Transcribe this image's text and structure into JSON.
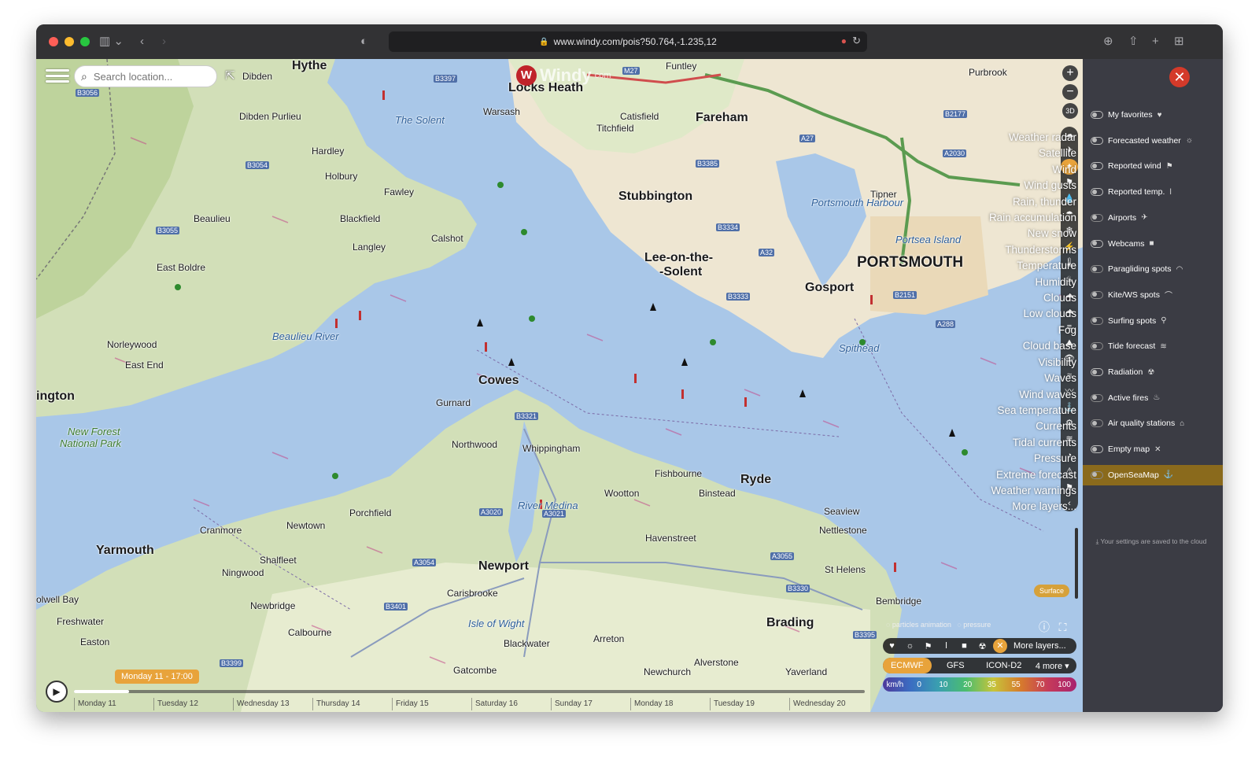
{
  "browser": {
    "url": "www.windy.com/pois?50.764,-1.235,12"
  },
  "map": {
    "search_placeholder": "Search location...",
    "logo_text": "Windy",
    "logo_suffix": "com",
    "places": [
      {
        "name": "Hythe",
        "cls": "big"
      },
      {
        "name": "Dibden",
        "cls": ""
      },
      {
        "name": "Locks Heath",
        "cls": "big"
      },
      {
        "name": "Funtley",
        "cls": ""
      },
      {
        "name": "Purbrook",
        "cls": ""
      },
      {
        "name": "Dibden Purlieu",
        "cls": ""
      },
      {
        "name": "Warsash",
        "cls": ""
      },
      {
        "name": "Catisfield",
        "cls": ""
      },
      {
        "name": "Titchfield",
        "cls": ""
      },
      {
        "name": "Fareham",
        "cls": "big"
      },
      {
        "name": "Hardley",
        "cls": ""
      },
      {
        "name": "Holbury",
        "cls": ""
      },
      {
        "name": "Fawley",
        "cls": ""
      },
      {
        "name": "Stubbington",
        "cls": "big"
      },
      {
        "name": "Beaulieu",
        "cls": ""
      },
      {
        "name": "Blackfield",
        "cls": ""
      },
      {
        "name": "Calshot",
        "cls": ""
      },
      {
        "name": "Langley",
        "cls": ""
      },
      {
        "name": "Tipner",
        "cls": ""
      },
      {
        "name": "Portsea Island",
        "cls": "water"
      },
      {
        "name": "PORTSMOUTH",
        "cls": "huge"
      },
      {
        "name": "East Boldre",
        "cls": ""
      },
      {
        "name": "Lee-on-the-",
        "cls": "big"
      },
      {
        "name": "-Solent",
        "cls": "big"
      },
      {
        "name": "Gosport",
        "cls": "big"
      },
      {
        "name": "Norleywood",
        "cls": ""
      },
      {
        "name": "East End",
        "cls": ""
      },
      {
        "name": "ington",
        "cls": "big"
      },
      {
        "name": "Cowes",
        "cls": "big"
      },
      {
        "name": "Gurnard",
        "cls": ""
      },
      {
        "name": "New Forest",
        "cls": "park"
      },
      {
        "name": "National Park",
        "cls": "park"
      },
      {
        "name": "Northwood",
        "cls": ""
      },
      {
        "name": "Whippingham",
        "cls": ""
      },
      {
        "name": "Fishbourne",
        "cls": ""
      },
      {
        "name": "Ryde",
        "cls": "big"
      },
      {
        "name": "Wootton",
        "cls": ""
      },
      {
        "name": "Binstead",
        "cls": ""
      },
      {
        "name": "Seaview",
        "cls": ""
      },
      {
        "name": "Nettlestone",
        "cls": ""
      },
      {
        "name": "Porchfield",
        "cls": ""
      },
      {
        "name": "Newtown",
        "cls": ""
      },
      {
        "name": "Cranmore",
        "cls": ""
      },
      {
        "name": "Havenstreet",
        "cls": ""
      },
      {
        "name": "Yarmouth",
        "cls": "big"
      },
      {
        "name": "Shalfleet",
        "cls": ""
      },
      {
        "name": "Ningwood",
        "cls": ""
      },
      {
        "name": "Newport",
        "cls": "big"
      },
      {
        "name": "St Helens",
        "cls": ""
      },
      {
        "name": "Bembridge",
        "cls": ""
      },
      {
        "name": "olwell Bay",
        "cls": ""
      },
      {
        "name": "Carisbrooke",
        "cls": ""
      },
      {
        "name": "Newbridge",
        "cls": ""
      },
      {
        "name": "Freshwater",
        "cls": ""
      },
      {
        "name": "Calbourne",
        "cls": ""
      },
      {
        "name": "Isle of Wight",
        "cls": "water"
      },
      {
        "name": "Brading",
        "cls": "big"
      },
      {
        "name": "Easton",
        "cls": ""
      },
      {
        "name": "Arreton",
        "cls": ""
      },
      {
        "name": "Blackwater",
        "cls": ""
      },
      {
        "name": "Alverstone",
        "cls": ""
      },
      {
        "name": "Newchurch",
        "cls": ""
      },
      {
        "name": "Gatcombe",
        "cls": ""
      },
      {
        "name": "Yaverland",
        "cls": ""
      },
      {
        "name": "The Solent",
        "cls": "water"
      },
      {
        "name": "Beaulieu River",
        "cls": "water"
      },
      {
        "name": "Portsmouth Harbour",
        "cls": "water"
      },
      {
        "name": "River Medina",
        "cls": "water"
      },
      {
        "name": "Spithead",
        "cls": "water"
      }
    ],
    "roads": [
      "B3397",
      "M27",
      "B3056",
      "B3054",
      "B3055",
      "B3385",
      "B3334",
      "A27",
      "B2177",
      "A2030",
      "A32",
      "B3333",
      "B2151",
      "A288",
      "B3321",
      "A3020",
      "A3021",
      "A3054",
      "B3401",
      "A3055",
      "B3330",
      "B3395",
      "B3399"
    ],
    "layers": [
      "Weather radar",
      "Satellite",
      "Wind",
      "Wind gusts",
      "Rain, thunder",
      "Rain accumulation",
      "New snow",
      "Thunderstorms",
      "Temperature",
      "Humidity",
      "Clouds",
      "Low clouds",
      "Fog",
      "Cloud base",
      "Visibility",
      "Waves",
      "Wind waves",
      "Sea temperature",
      "Currents",
      "Tidal currents",
      "Pressure",
      "Extreme forecast",
      "Weather warnings",
      "More layers..."
    ],
    "layer_icons": [
      "☁",
      "✈",
      "✦",
      "⚑",
      "💧",
      "☂",
      "❄",
      "⚡",
      "🌡",
      "♨",
      "☁",
      "☁",
      "≡",
      "⛰",
      "👁",
      "≈",
      "〰",
      "⚓",
      "⚙",
      "≋",
      "◔",
      "⚠",
      "⚑",
      "‹"
    ],
    "surface_label": "Surface",
    "particles_label": "particles animation",
    "pressure_label": "pressure",
    "more_layers_label": "More layers...",
    "models": [
      "ECMWF",
      "GFS",
      "ICON-D2",
      "4 more ▾"
    ],
    "selected_model": "ECMWF",
    "legend_unit": "km/h",
    "legend_values": [
      "0",
      "10",
      "20",
      "35",
      "55",
      "70",
      "100"
    ],
    "timeline": {
      "current": "Monday 11 - 17:00",
      "progress_fraction": 0.07,
      "days": [
        "Monday 11",
        "Tuesday 12",
        "Wednesday 13",
        "Thursday 14",
        "Friday 15",
        "Saturday 16",
        "Sunday 17",
        "Monday 18",
        "Tuesday 19",
        "Wednesday 20"
      ]
    }
  },
  "panel": {
    "items": [
      {
        "label": "My favorites",
        "icon": "heart-icon",
        "glyph": "♥",
        "on": true
      },
      {
        "label": "Forecasted weather",
        "icon": "weather-icon",
        "glyph": "☼",
        "on": true
      },
      {
        "label": "Reported wind",
        "icon": "flag-icon",
        "glyph": "⚑",
        "on": true
      },
      {
        "label": "Reported temp.",
        "icon": "thermometer-icon",
        "glyph": "ǀ",
        "on": true
      },
      {
        "label": "Airports",
        "icon": "plane-icon",
        "glyph": "✈",
        "on": false
      },
      {
        "label": "Webcams",
        "icon": "camera-icon",
        "glyph": "■",
        "on": true
      },
      {
        "label": "Paragliding spots",
        "icon": "paraglider-icon",
        "glyph": "◠",
        "on": false
      },
      {
        "label": "Kite/WS spots",
        "icon": "kite-icon",
        "glyph": "⌒",
        "on": false
      },
      {
        "label": "Surfing spots",
        "icon": "surfer-icon",
        "glyph": "⚲",
        "on": false
      },
      {
        "label": "Tide forecast",
        "icon": "tide-icon",
        "glyph": "≋",
        "on": false
      },
      {
        "label": "Radiation",
        "icon": "radiation-icon",
        "glyph": "☢",
        "on": true
      },
      {
        "label": "Active fires",
        "icon": "fire-icon",
        "glyph": "♨",
        "on": false
      },
      {
        "label": "Air quality stations",
        "icon": "factory-icon",
        "glyph": "⌂",
        "on": false
      },
      {
        "label": "Empty map",
        "icon": "close-icon",
        "glyph": "✕",
        "on": true
      },
      {
        "label": "OpenSeaMap",
        "icon": "anchor-icon",
        "glyph": "⚓",
        "on": false
      }
    ],
    "active_item": "OpenSeaMap",
    "note": "⤓ Your settings are saved to the cloud"
  }
}
